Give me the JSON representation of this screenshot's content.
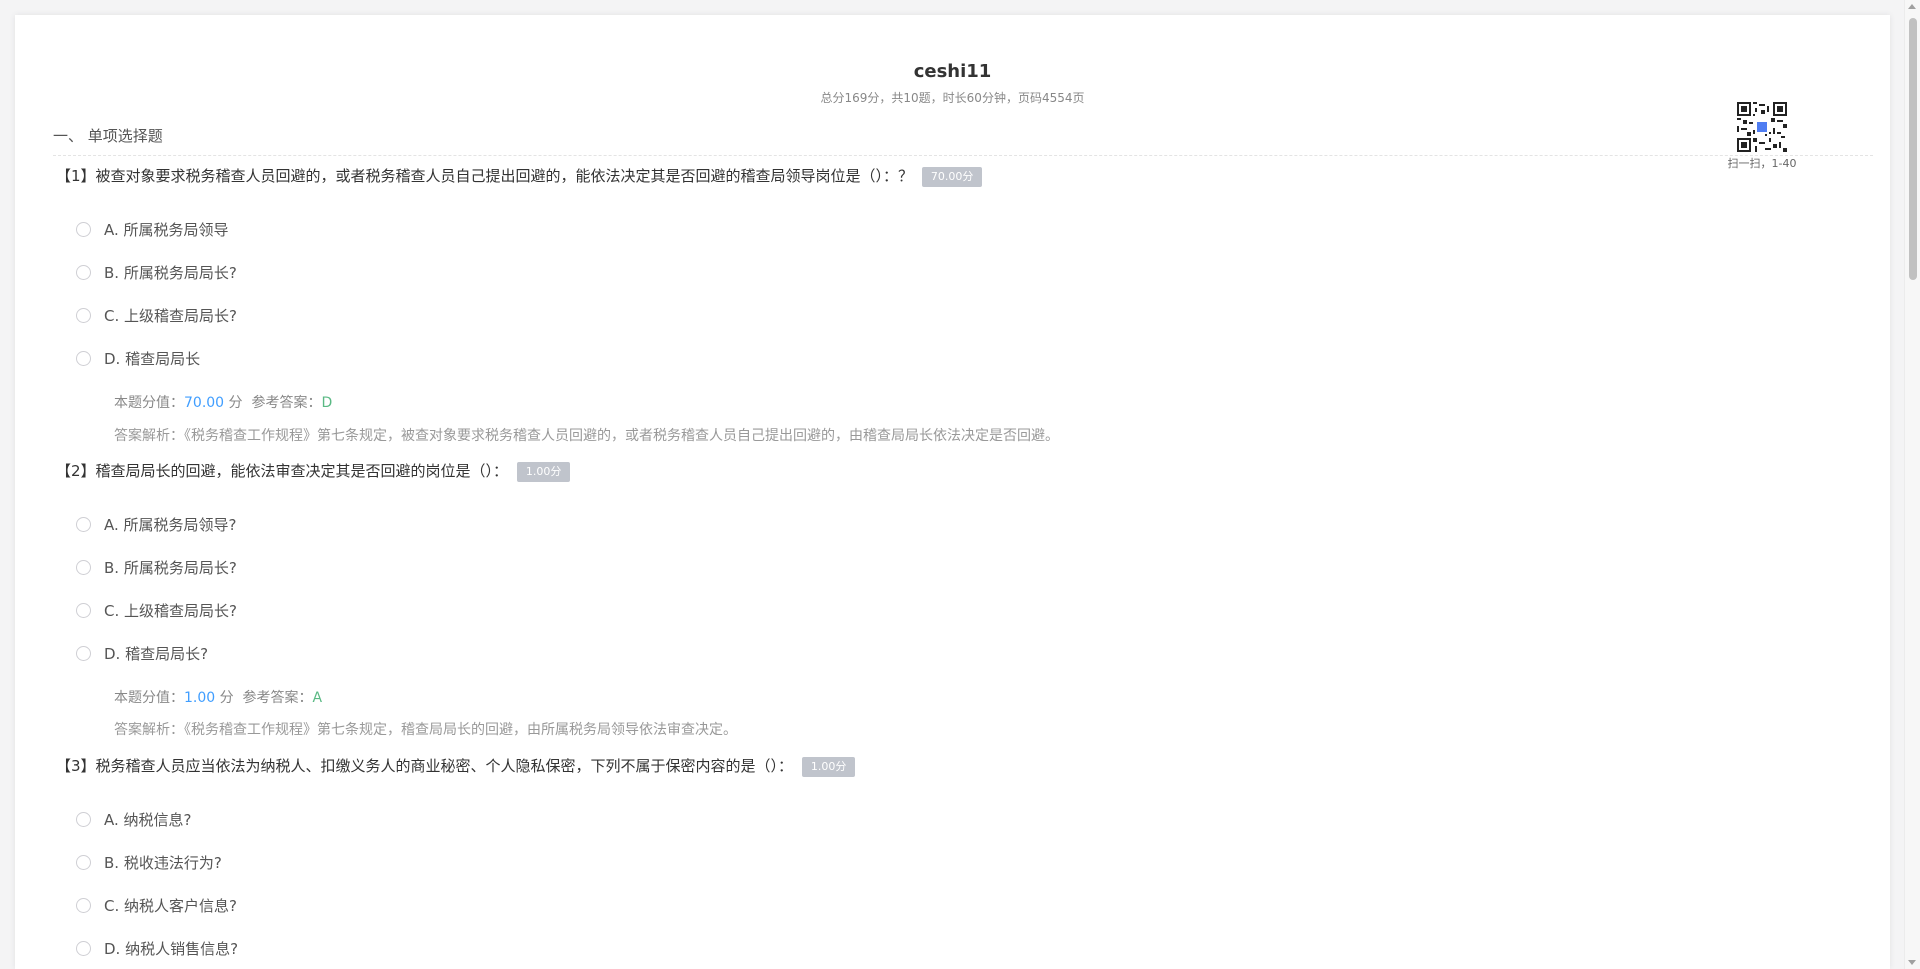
{
  "header": {
    "title": "ceshi11",
    "subtitle": "总分169分，共10题，时长60分钟，页码4554页"
  },
  "qr": {
    "caption": "扫一扫，1-40"
  },
  "section": {
    "title": "一、 单项选择题"
  },
  "labels": {
    "score_prefix": "本题分值：",
    "score_unit": "分",
    "answer_prefix": "参考答案：",
    "analysis_prefix": "答案解析："
  },
  "questions": [
    {
      "text": "【1】被查对象要求税务稽查人员回避的，或者税务稽查人员自己提出回避的，能依法决定其是否回避的稽查局领导岗位是（）：？",
      "badge": "70.00分",
      "options": [
        "A. 所属税务局领导",
        "B. 所属税务局局长?",
        "C. 上级稽查局局长?",
        "D. 稽查局局长"
      ],
      "score": "70.00",
      "answer": "D",
      "analysis": "《税务稽查工作规程》第七条规定，被查对象要求税务稽查人员回避的，或者税务稽查人员自己提出回避的，由稽查局局长依法决定是否回避。"
    },
    {
      "text": "【2】稽查局局长的回避，能依法审查决定其是否回避的岗位是（）：",
      "badge": "1.00分",
      "options": [
        "A. 所属税务局领导?",
        "B. 所属税务局局长?",
        "C. 上级稽查局局长?",
        "D. 稽查局局长?"
      ],
      "score": "1.00",
      "answer": "A",
      "analysis": "《税务稽查工作规程》第七条规定，稽查局局长的回避，由所属税务局领导依法审查决定。"
    },
    {
      "text": "【3】税务稽查人员应当依法为纳税人、扣缴义务人的商业秘密、个人隐私保密，下列不属于保密内容的是（）：",
      "badge": "1.00分",
      "options": [
        "A. 纳税信息?",
        "B. 税收违法行为?",
        "C. 纳税人客户信息?",
        "D. 纳税人销售信息?"
      ]
    }
  ]
}
